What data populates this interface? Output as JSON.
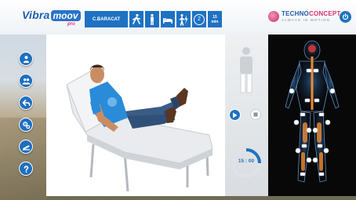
{
  "app": {
    "logo_main": "Vibra",
    "logo_highlight": "moov",
    "logo_suffix": "pro"
  },
  "toolbar": {
    "patient_name": "C.BARACAT",
    "buttons": [
      {
        "icon": "walking-person-icon"
      },
      {
        "icon": "standing-person-icon"
      },
      {
        "icon": "bed-icon"
      },
      {
        "icon": "person-lightning-icon"
      }
    ],
    "counter": "2",
    "time_value": "15",
    "time_unit": "min"
  },
  "brand": {
    "name_a": "TECHNO",
    "name_b": "CONCEPT",
    "tagline": "ALWAYS IN MOTION"
  },
  "sidebar": {
    "items": [
      {
        "icon": "patient-profile-icon"
      },
      {
        "icon": "patients-group-icon"
      },
      {
        "icon": "back-arrow-icon"
      },
      {
        "icon": "settings-gears-icon"
      },
      {
        "icon": "stimulation-device-icon"
      },
      {
        "icon": "help-icon"
      }
    ]
  },
  "player": {
    "timer": "15 : 00",
    "progress": 0.25
  },
  "colors": {
    "primary": "#1e72c2",
    "brand_accent": "#d8346b",
    "stimulation_point": "#f08a2c"
  }
}
